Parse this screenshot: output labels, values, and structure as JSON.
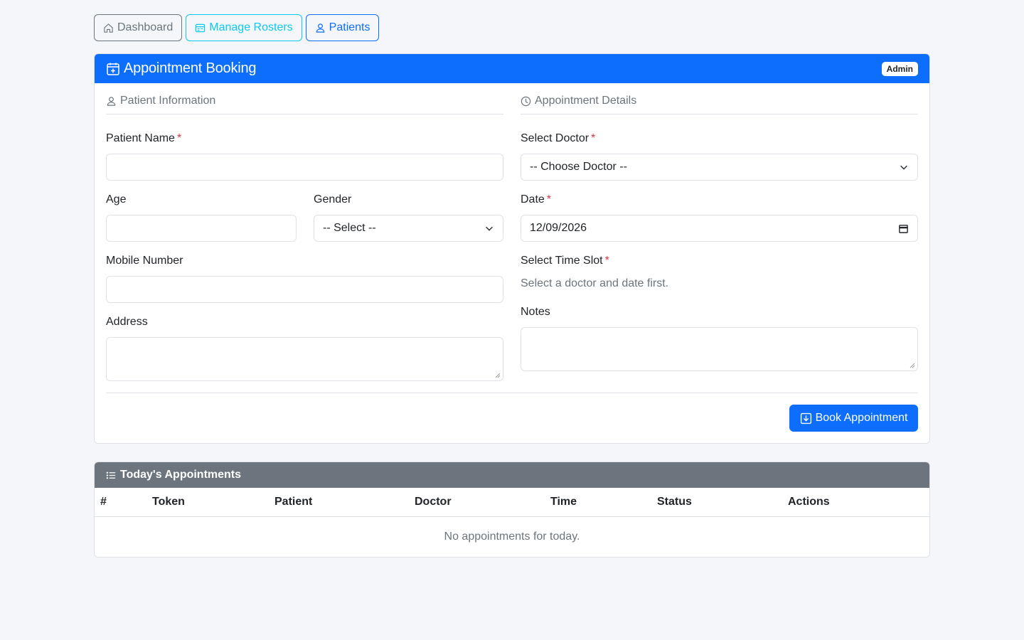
{
  "nav": {
    "dashboard": "Dashboard",
    "manage_rosters": "Manage Rosters",
    "patients": "Patients"
  },
  "booking": {
    "title": "Appointment Booking",
    "role_badge": "Admin",
    "patient_section": "Patient Information",
    "appointment_section": "Appointment Details",
    "patient_name_label": "Patient Name",
    "age_label": "Age",
    "gender_label": "Gender",
    "gender_value": "-- Select --",
    "mobile_label": "Mobile Number",
    "address_label": "Address",
    "doctor_label": "Select Doctor",
    "doctor_value": "-- Choose Doctor --",
    "date_label": "Date",
    "date_value": "12/09/2026",
    "time_slot_label": "Select Time Slot",
    "time_slot_hint": "Select a doctor and date first.",
    "notes_label": "Notes",
    "required_mark": "*",
    "submit": "Book Appointment"
  },
  "appointments": {
    "title": "Today's Appointments",
    "columns": [
      "#",
      "Token",
      "Patient",
      "Doctor",
      "Time",
      "Status",
      "Actions"
    ],
    "empty": "No appointments for today."
  },
  "colors": {
    "primary": "#0d6efd",
    "secondary": "#6c757d",
    "info": "#0dcaf0",
    "danger": "#dc3545",
    "background": "#f4f6f9"
  }
}
